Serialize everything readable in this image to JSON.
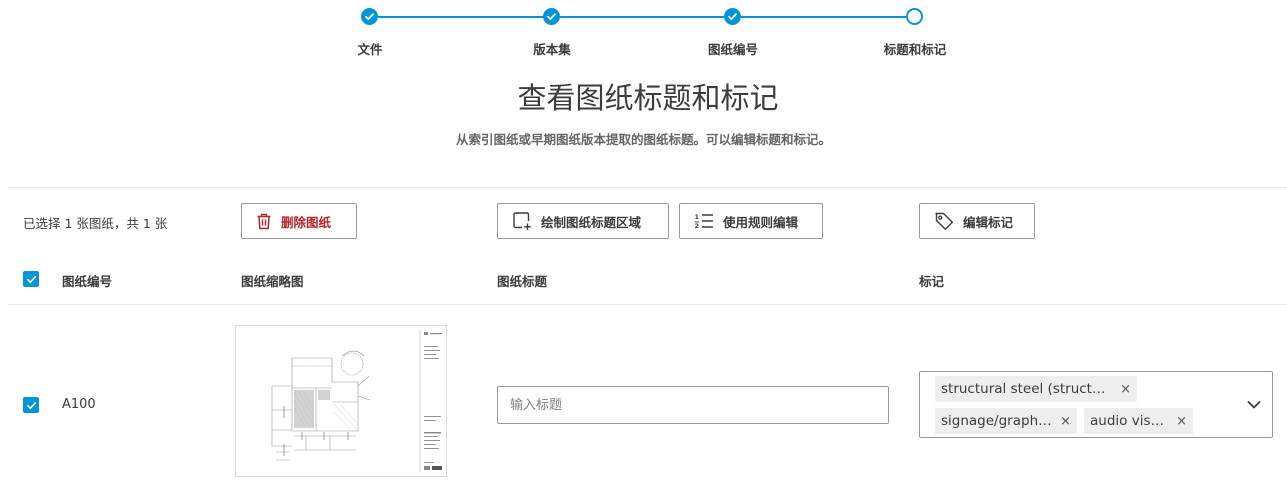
{
  "stepper": {
    "steps": [
      {
        "label": "文件",
        "state": "complete"
      },
      {
        "label": "版本集",
        "state": "complete"
      },
      {
        "label": "图纸编号",
        "state": "complete"
      },
      {
        "label": "标题和标记",
        "state": "current"
      }
    ]
  },
  "header": {
    "title": "查看图纸标题和标记",
    "subtitle": "从索引图纸或早期图纸版本提取的图纸标题。可以编辑标题和标记。"
  },
  "toolbar": {
    "selection_count": "已选择 1 张图纸，共 1 张",
    "delete_label": "删除图纸",
    "draw_region_label": "绘制图纸标题区域",
    "edit_rules_label": "使用规则编辑",
    "edit_tags_label": "编辑标记"
  },
  "table": {
    "columns": [
      "图纸编号",
      "图纸缩略图",
      "图纸标题",
      "标记"
    ],
    "select_all_checked": true,
    "rows": [
      {
        "checked": true,
        "sheet_number": "A100",
        "title_value": "",
        "title_placeholder": "输入标题",
        "tags": [
          "structural steel (structu…",
          "signage/graphics",
          "audio visual"
        ]
      }
    ]
  },
  "colors": {
    "accent": "#0696d7",
    "danger": "#b8242a",
    "chip_bg": "#eeeeee"
  }
}
